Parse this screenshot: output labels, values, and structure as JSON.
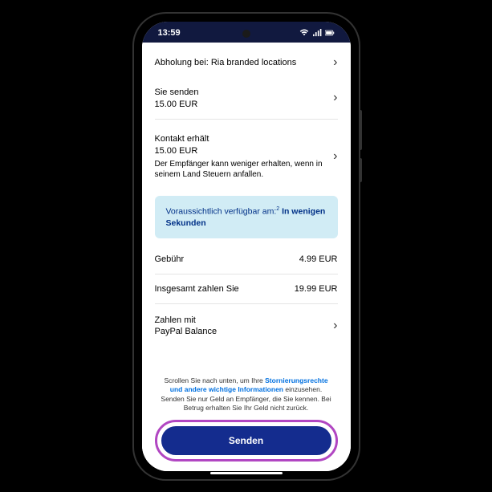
{
  "status": {
    "time": "13:59"
  },
  "pickup": {
    "label": "Abholung bei: Ria branded locations"
  },
  "send": {
    "label": "Sie senden",
    "value": "15.00  EUR"
  },
  "receive": {
    "label": "Kontakt erhält",
    "value": "15.00  EUR",
    "note": "Der Empfänger kann weniger erhalten, wenn in seinem Land Steuern anfallen."
  },
  "availability": {
    "prefix": "Voraussichtlich verfügbar am:",
    "sup": "2",
    "bold": "In wenigen Sekunden"
  },
  "fee": {
    "label": "Gebühr",
    "value": "4.99 EUR"
  },
  "total": {
    "label": "Insgesamt zahlen Sie",
    "value": "19.99 EUR"
  },
  "payWith": {
    "label": "Zahlen mit",
    "method": "PayPal Balance"
  },
  "disclaimer": {
    "part1": "Scrollen Sie nach unten, um Ihre ",
    "link": "Stornierungsrechte und andere wichtige Informationen",
    "part2": " einzusehen. Senden Sie nur Geld an Empfänger, die Sie kennen. Bei Betrug erhalten Sie Ihr Geld nicht zurück."
  },
  "button": {
    "send": "Senden"
  }
}
